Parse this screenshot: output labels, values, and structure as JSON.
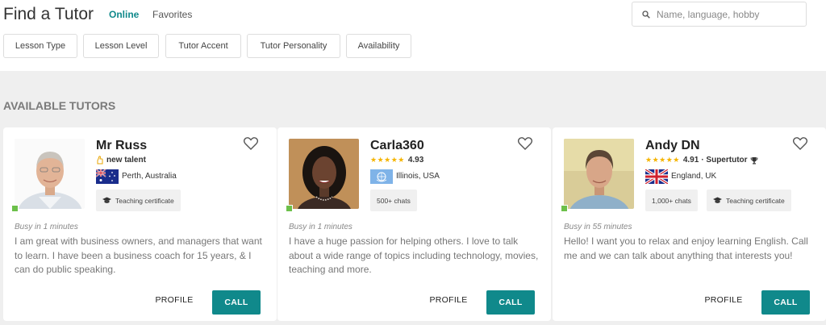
{
  "header": {
    "title": "Find a Tutor",
    "tabs": [
      {
        "label": "Online",
        "active": true
      },
      {
        "label": "Favorites",
        "active": false
      }
    ],
    "search": {
      "placeholder": "Name, language, hobby",
      "value": ""
    }
  },
  "filters": [
    "Lesson Type",
    "Lesson Level",
    "Tutor Accent",
    "Tutor Personality",
    "Availability"
  ],
  "section_title": "AVAILABLE TUTORS",
  "colors": {
    "accent": "#10898b",
    "online": "#6cc04a",
    "star": "#f5b400"
  },
  "tutors": [
    {
      "name": "Mr Russ",
      "status_icon": "new-talent-icon",
      "status_text": "new talent",
      "flag": "australia-flag-icon",
      "location": "Perth, Australia",
      "badges": [
        {
          "icon": "graduation-cap-icon",
          "label": "Teaching certificate"
        }
      ],
      "busy": "Busy in 1 minutes",
      "description": "I am great with business owners, and managers that want to learn. I have been a business coach for 15 years, & I can do public speaking.",
      "profile_label": "PROFILE",
      "call_label": "CALL"
    },
    {
      "name": "Carla360",
      "stars": "★★★★★",
      "rating": "4.93",
      "flag": "un-flag-icon",
      "location": "Illinois, USA",
      "badges": [
        {
          "label": "500+ chats"
        }
      ],
      "busy": "Busy in 1 minutes",
      "description": "I have a huge passion for helping others. I love to talk about a wide range of topics including technology, movies, teaching and more.",
      "profile_label": "PROFILE",
      "call_label": "CALL"
    },
    {
      "name": "Andy DN",
      "stars": "★★★★★",
      "rating": "4.91",
      "supertutor": "· Supertutor",
      "flag": "uk-flag-icon",
      "location": "England, UK",
      "badges": [
        {
          "label": "1,000+ chats"
        },
        {
          "icon": "graduation-cap-icon",
          "label": "Teaching certificate"
        }
      ],
      "busy": "Busy in 55 minutes",
      "description": "Hello! I want you to relax and enjoy learning English. Call me and we can talk about anything that interests you!",
      "profile_label": "PROFILE",
      "call_label": "CALL"
    }
  ]
}
